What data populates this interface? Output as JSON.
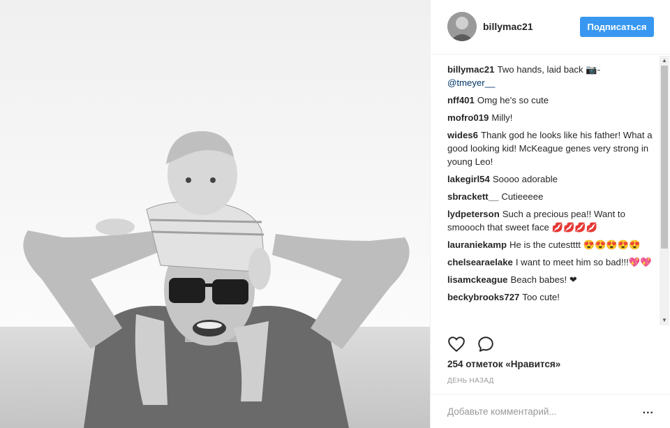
{
  "header": {
    "username": "billymac21",
    "follow_label": "Подписаться"
  },
  "comments": [
    {
      "author": "billymac21",
      "text": "Two hands, laid back ",
      "camera": "📷",
      "dash": "- ",
      "mention": "@tmeyer__"
    },
    {
      "author": "nff401",
      "text": "Omg he's so cute"
    },
    {
      "author": "mofro019",
      "text": "Milly!"
    },
    {
      "author": "wides6",
      "text": "Thank god he looks like his father! What a good looking kid! McKeague genes very strong in young Leo!"
    },
    {
      "author": "lakegirl54",
      "text": "Soooo adorable"
    },
    {
      "author": "sbrackett__",
      "text": "Cutieeeee"
    },
    {
      "author": "lydpeterson",
      "text": "Such a precious pea!! Want to smoooch that sweet face 💋💋💋💋"
    },
    {
      "author": "lauraniekamp",
      "text": "He is the cutestttt 😍😍😍😍😍"
    },
    {
      "author": "chelsearaelake",
      "text": "I want to meet him so bad!!!💖💖"
    },
    {
      "author": "lisamckeague",
      "text": "Beach babes! ❤"
    },
    {
      "author": "beckybrooks727",
      "text": "Too cute!"
    }
  ],
  "actions": {
    "like_icon": "heart-outline-icon",
    "comment_icon": "speech-bubble-icon"
  },
  "likes_text": "254 отметок «Нравится»",
  "time_text": "ДЕНЬ НАЗАД",
  "add_comment": {
    "placeholder": "Добавьте комментарий...",
    "more_label": "..."
  },
  "colors": {
    "follow_button": "#3897f0",
    "text": "#262626",
    "muted": "#999999",
    "link": "#003569"
  }
}
